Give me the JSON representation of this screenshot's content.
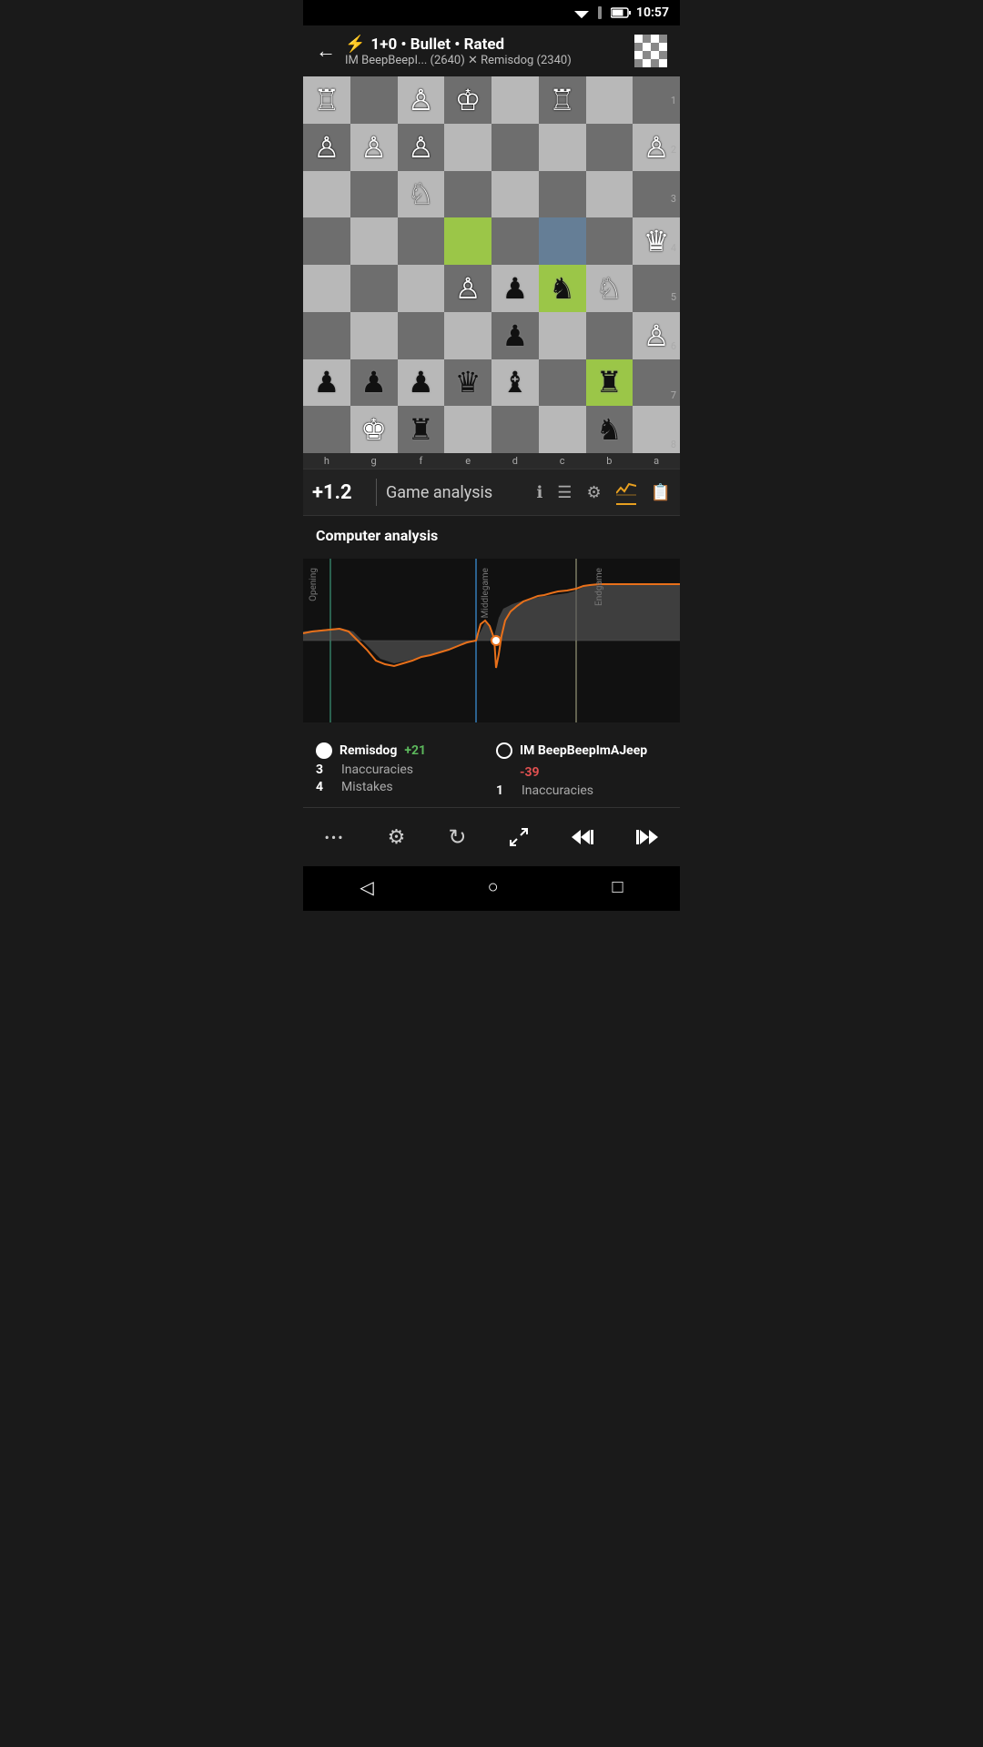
{
  "statusBar": {
    "time": "10:57"
  },
  "header": {
    "backLabel": "←",
    "bolt": "⚡",
    "title": "1+0 • Bullet • Rated",
    "subtitle": "IM BeepBeepI... (2640) ✕ Remisdog (2340)"
  },
  "board": {
    "rankLabels": [
      "1",
      "2",
      "3",
      "4",
      "5",
      "6",
      "7",
      "8"
    ],
    "fileLabels": [
      "h",
      "g",
      "f",
      "e",
      "d",
      "c",
      "b",
      "a"
    ]
  },
  "analysisBar": {
    "evalScore": "+1.2",
    "title": "Game analysis",
    "icons": [
      {
        "name": "info-icon",
        "symbol": "ℹ",
        "active": false
      },
      {
        "name": "list-icon",
        "symbol": "☰",
        "active": false
      },
      {
        "name": "gear-icon",
        "symbol": "⚙",
        "active": false
      },
      {
        "name": "chart-icon",
        "symbol": "📈",
        "active": true
      },
      {
        "name": "book-icon",
        "symbol": "📋",
        "active": false
      }
    ]
  },
  "computerAnalysis": {
    "title": "Computer analysis",
    "phaseLabels": {
      "opening": "Opening",
      "middlegame": "Middlegame",
      "endgame": "Endgame"
    }
  },
  "players": [
    {
      "name": "Remisdog",
      "scoreLabel": "+21",
      "scoreClass": "pos",
      "dotClass": "white-player",
      "stats": [
        {
          "count": "3",
          "label": "Inaccuracies"
        },
        {
          "count": "4",
          "label": "Mistakes"
        }
      ]
    },
    {
      "name": "IM BeepBeepImAJeep",
      "scoreLabel": "-39",
      "scoreClass": "neg",
      "dotClass": "black-player",
      "stats": [
        {
          "count": "1",
          "label": "Inaccuracies"
        }
      ]
    }
  ],
  "bottomToolbar": {
    "buttons": [
      {
        "name": "more-button",
        "symbol": "•••"
      },
      {
        "name": "settings-button",
        "symbol": "⚙"
      },
      {
        "name": "flip-button",
        "symbol": "↻"
      },
      {
        "name": "arrows-button",
        "symbol": "⤢"
      },
      {
        "name": "prev-button",
        "symbol": "⏮"
      },
      {
        "name": "next-button",
        "symbol": "⏭"
      }
    ]
  },
  "navBar": {
    "back": "◁",
    "home": "○",
    "recents": "□"
  }
}
